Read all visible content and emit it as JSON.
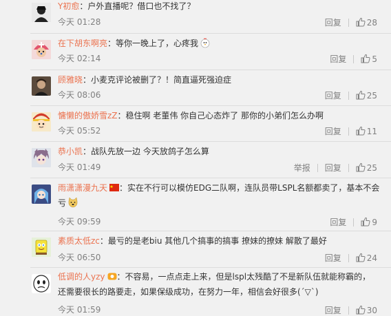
{
  "common": {
    "reply_label": "回复",
    "report_label": "举报",
    "colon": "："
  },
  "comments": [
    {
      "user": "Y初愈",
      "text": "户外直播呢？借口也不找了？",
      "time": "今天 01:28",
      "likes": "28",
      "action_label": "回复"
    },
    {
      "user": "在下胡东啊亮",
      "text": "等你一晚上了，心疼我",
      "time": "今天 02:14",
      "likes": "5",
      "action_label": "回复",
      "emoji": "chicken-emoji"
    },
    {
      "user": "顾雅晓",
      "text": "小麦克评论被删了？！简直逼死强迫症",
      "time": "今天 08:06",
      "likes": "25",
      "action_label": "回复"
    },
    {
      "user": "慵懒的傲娇雪zZ",
      "text": "稳住啊 老董伟 你自己心态炸了 那你的小弟们怎么办啊",
      "time": "今天 05:52",
      "likes": "11",
      "action_label": "回复"
    },
    {
      "user": "恭小凯",
      "text": "战队先放一边 今天放鸽子怎么算",
      "time": "今天 01:49",
      "likes": "25",
      "action_label": "举报"
    },
    {
      "user": "雨潇潇漫九天",
      "text": "实在不行可以模仿EDG二队啊，连队员带LSPL名额都卖了，基本不会亏",
      "time": "今天 09:59",
      "likes": "9",
      "action_label": "回复",
      "emoji": "doge-emoji",
      "badge": "china-flag-badge"
    },
    {
      "user": "素质太低zc",
      "text": "最亏的是老biu 其他几个搞事的搞事 撩妹的撩妹 解散了最好",
      "time": "今天 06:50",
      "likes": "24",
      "action_label": "回复"
    },
    {
      "user": "低调的人yzy",
      "text": "不容易，一点点走上来，但是lspl太残酷了不是新队伍就能称霸的，还需要很长的路要走，如果保级成功，在努力一年，相信会好很多(´▽`)",
      "time": "今天 01:59",
      "likes": "30",
      "action_label": "回复",
      "badge": "vip-badge"
    }
  ]
}
